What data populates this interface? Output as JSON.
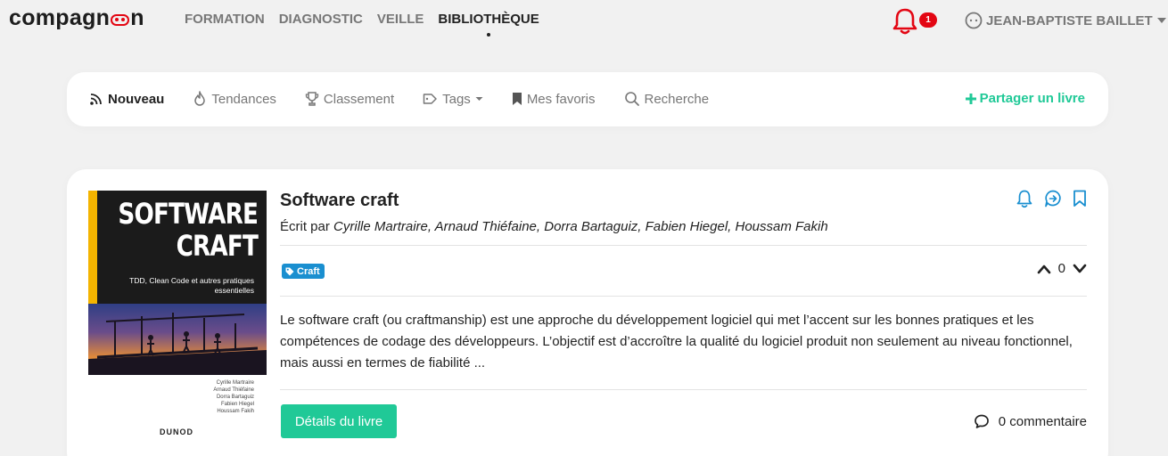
{
  "brand": {
    "logo_text_before": "compagn",
    "logo_text_after": "n",
    "accent": "#e30613"
  },
  "nav": {
    "items": [
      "FORMATION",
      "DIAGNOSTIC",
      "VEILLE",
      "BIBLIOTHÈQUE"
    ],
    "active": "BIBLIOTHÈQUE"
  },
  "notifications": {
    "icon": "bell-icon",
    "count": "1"
  },
  "user": {
    "name": "JEAN-BAPTISTE BAILLET",
    "icon": "user-circle-icon"
  },
  "subnav": {
    "items": [
      {
        "label": "Nouveau",
        "icon": "rss-icon",
        "active": true
      },
      {
        "label": "Tendances",
        "icon": "flame-icon",
        "active": false
      },
      {
        "label": "Classement",
        "icon": "trophy-icon",
        "active": false
      },
      {
        "label": "Tags",
        "icon": "tag-icon",
        "active": false,
        "dropdown": true
      },
      {
        "label": "Mes favoris",
        "icon": "bookmark-icon",
        "active": false
      },
      {
        "label": "Recherche",
        "icon": "search-icon",
        "active": false
      }
    ],
    "share_label": "Partager un livre",
    "share_color": "#20c997"
  },
  "book": {
    "title": "Software craft",
    "authors_prefix": "Écrit par",
    "authors": "Cyrille Martraire, Arnaud Thiéfaine, Dorra Bartaguiz, Fabien Hiegel, Houssam Fakih",
    "tag": "Craft",
    "tag_color": "#1a8fd0",
    "votes": "0",
    "description": "Le software craft (ou craftmanship) est une approche du développement logiciel qui met l’accent sur les bonnes pratiques et les compétences de codage des développeurs. L’objectif est d’accroître la qualité du logiciel produit non seulement au niveau fonctionnel, mais aussi en termes de fiabilité ...",
    "details_label": "Détails du livre",
    "comments_label": "0 commentaire",
    "cover": {
      "title_line1": "SOFTWARE",
      "title_line2": "CRAFT",
      "subtitle": "TDD, Clean Code et autres pratiques essentielles",
      "authors": [
        "Cyrille Martraire",
        "Arnaud Thiéfaine",
        "Dorra Bartaguiz",
        "Fabien Hiegel",
        "Houssam Fakih"
      ],
      "publisher": "DUNOD"
    }
  }
}
